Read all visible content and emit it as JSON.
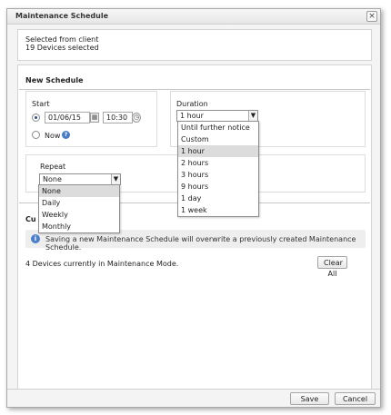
{
  "dialog": {
    "title": "Maintenance Schedule",
    "close_glyph": "×"
  },
  "selection": {
    "line1": "Selected from client",
    "line2": "19 Devices selected"
  },
  "new_schedule": {
    "title": "New Schedule",
    "start": {
      "label": "Start",
      "date_value": "01/06/15",
      "time_value": "10:30",
      "now_label": "Now",
      "selected": "date"
    },
    "duration": {
      "label": "Duration",
      "selected_value": "1 hour",
      "options": [
        "Until further notice",
        "Custom",
        "1 hour",
        "2 hours",
        "3 hours",
        "9 hours",
        "1 day",
        "1 week"
      ],
      "highlighted_index": 2
    },
    "repeat": {
      "label": "Repeat",
      "selected_value": "None",
      "options": [
        "None",
        "Daily",
        "Weekly",
        "Monthly"
      ],
      "highlighted_index": 0
    }
  },
  "current": {
    "title_fragment": "Cu",
    "info_text": "Saving a new Maintenance Schedule will overwrite a previously created Maintenance Schedule.",
    "maintenance_text": "4 Devices currently in Maintenance Mode.",
    "clear_all_label": "Clear All"
  },
  "footer": {
    "save_label": "Save",
    "cancel_label": "Cancel"
  },
  "icons": {
    "calendar": "calendar-icon",
    "clock": "clock-icon",
    "help": "help-icon",
    "info": "info-icon",
    "dropdown": "chevron-down-icon"
  }
}
